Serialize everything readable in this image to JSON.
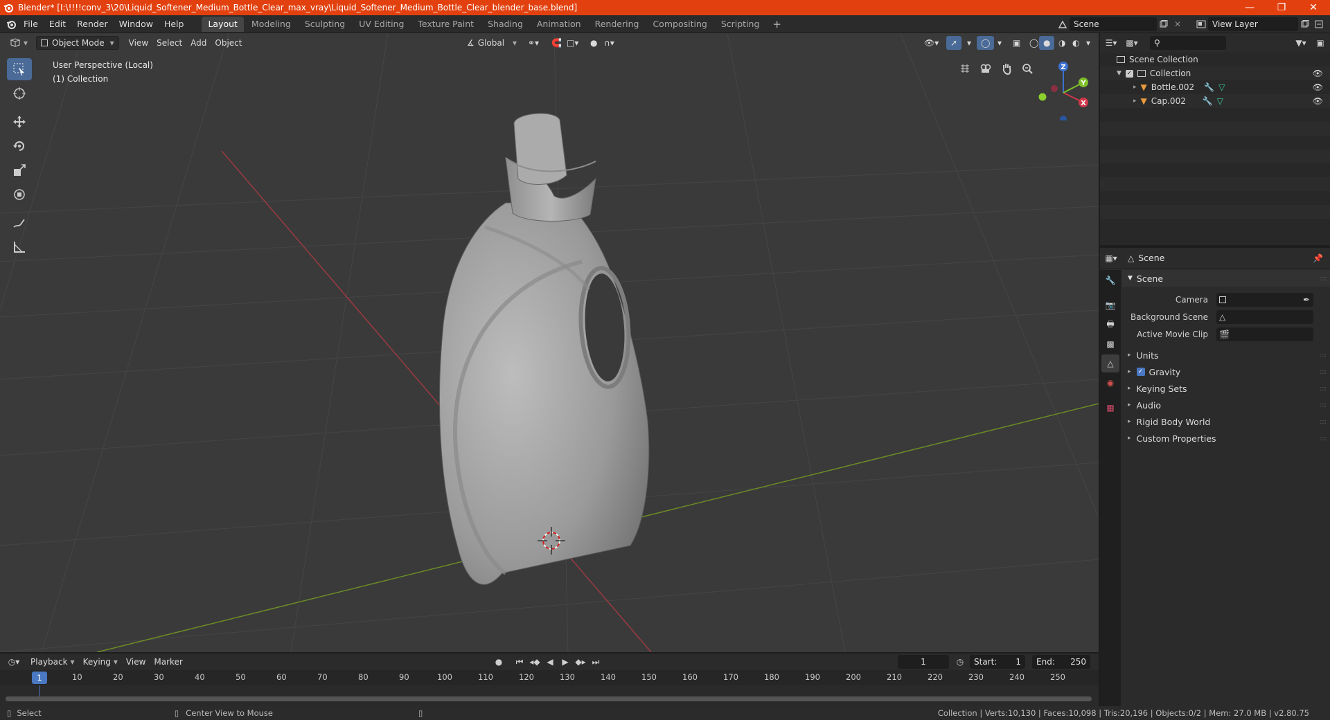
{
  "window": {
    "title": "Blender* [I:\\!!!!conv_3\\20\\Liquid_Softener_Medium_Bottle_Clear_max_vray\\Liquid_Softener_Medium_Bottle_Clear_blender_base.blend]"
  },
  "menus": [
    "File",
    "Edit",
    "Render",
    "Window",
    "Help"
  ],
  "workspaces": [
    {
      "label": "Layout",
      "active": true
    },
    {
      "label": "Modeling",
      "active": false
    },
    {
      "label": "Sculpting",
      "active": false
    },
    {
      "label": "UV Editing",
      "active": false
    },
    {
      "label": "Texture Paint",
      "active": false
    },
    {
      "label": "Shading",
      "active": false
    },
    {
      "label": "Animation",
      "active": false
    },
    {
      "label": "Rendering",
      "active": false
    },
    {
      "label": "Compositing",
      "active": false
    },
    {
      "label": "Scripting",
      "active": false
    }
  ],
  "scene_selector": {
    "value": "Scene"
  },
  "view_layer_selector": {
    "value": "View Layer"
  },
  "viewport": {
    "mode": "Object Mode",
    "menus": [
      "View",
      "Select",
      "Add",
      "Object"
    ],
    "transform_orientation": "Global",
    "info_line1": "User Perspective (Local)",
    "info_line2": "(1) Collection",
    "gizmo": {
      "x": "X",
      "y": "Y",
      "z": "Z"
    }
  },
  "outliner": {
    "root": "Scene Collection",
    "collection": "Collection",
    "objects": [
      "Bottle.002",
      "Cap.002"
    ]
  },
  "properties": {
    "header": "Scene",
    "panel": "Scene",
    "rows": [
      {
        "label": "Camera"
      },
      {
        "label": "Background Scene"
      },
      {
        "label": "Active Movie Clip"
      }
    ],
    "subpanels": [
      "Units",
      "Gravity",
      "Keying Sets",
      "Audio",
      "Rigid Body World",
      "Custom Properties"
    ]
  },
  "timeline": {
    "menus": [
      "Playback",
      "Keying",
      "View",
      "Marker"
    ],
    "current_frame": "1",
    "start_label": "Start:",
    "start": "1",
    "end_label": "End:",
    "end": "250",
    "ticks": [
      "10",
      "20",
      "30",
      "40",
      "50",
      "60",
      "70",
      "80",
      "90",
      "100",
      "110",
      "120",
      "130",
      "140",
      "150",
      "160",
      "170",
      "180",
      "190",
      "200",
      "210",
      "220",
      "230",
      "240",
      "250"
    ]
  },
  "statusbar": {
    "left_action": "Select",
    "middle_action": "Center View to Mouse",
    "stats": "Collection | Verts:10,130 | Faces:10,098 | Tris:20,196 | Objects:0/2 | Mem: 27.0 MB | v2.80.75"
  },
  "colors": {
    "titlebar": "#e2410f",
    "accent_blue": "#4a6a97",
    "viewport_bg": "#3c3c3c",
    "x_axis": "#a0343e",
    "y_axis": "#6a8c23"
  }
}
